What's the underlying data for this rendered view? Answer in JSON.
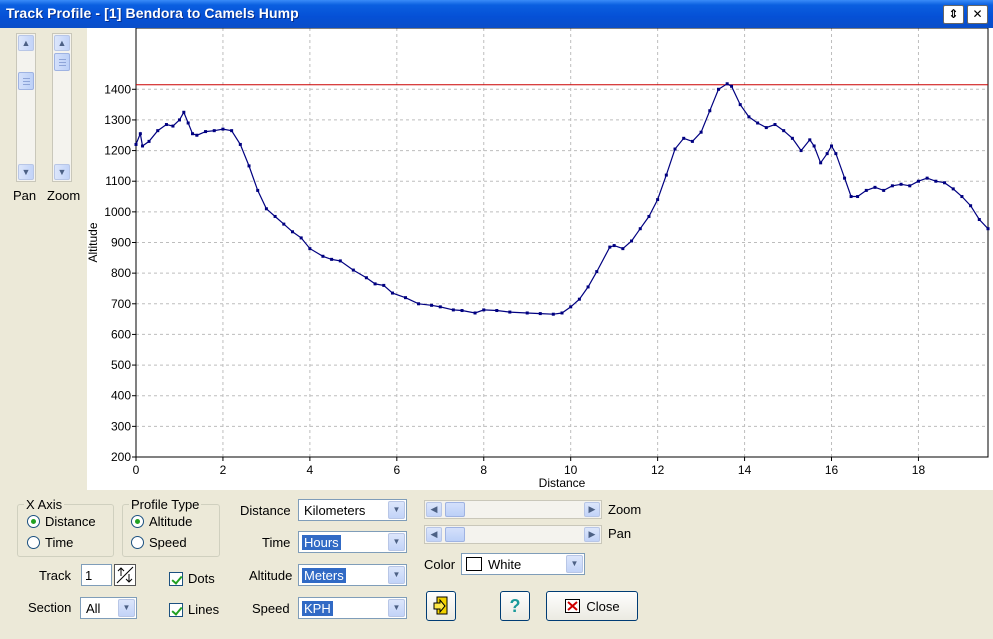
{
  "window": {
    "title": "Track Profile - [1] Bendora to Camels Hump"
  },
  "left_panel": {
    "pan_label": "Pan",
    "zoom_label": "Zoom"
  },
  "x_axis_group": {
    "title": "X Axis",
    "options": [
      "Distance",
      "Time"
    ],
    "selected": "Distance"
  },
  "profile_group": {
    "title": "Profile Type",
    "options": [
      "Altitude",
      "Speed"
    ],
    "selected": "Altitude"
  },
  "track": {
    "label": "Track",
    "value": "1"
  },
  "section": {
    "label": "Section",
    "value": "All"
  },
  "checks": {
    "dots_label": "Dots",
    "dots": true,
    "lines_label": "Lines",
    "lines": true
  },
  "units": {
    "distance_label": "Distance",
    "distance_value": "Kilometers",
    "time_label": "Time",
    "time_value": "Hours",
    "altitude_label": "Altitude",
    "altitude_value": "Meters",
    "speed_label": "Speed",
    "speed_value": "KPH"
  },
  "sliders": {
    "zoom_label": "Zoom",
    "pan_label": "Pan"
  },
  "color": {
    "label": "Color",
    "value": "White",
    "swatch": "#ffffff"
  },
  "buttons": {
    "close_label": "Close",
    "help_glyph": "?"
  },
  "chart_data": {
    "type": "line",
    "xlabel": "Distance",
    "ylabel": "Altitude",
    "xlim": [
      0,
      19.6
    ],
    "ylim": [
      200,
      1600
    ],
    "xticks": [
      0,
      2,
      4,
      6,
      8,
      10,
      12,
      14,
      16,
      18
    ],
    "yticks": [
      200,
      300,
      400,
      500,
      600,
      700,
      800,
      900,
      1000,
      1100,
      1200,
      1300,
      1400
    ],
    "max_line": 1415,
    "grid": true,
    "line_color": "#000080",
    "max_line_color": "#cc0000",
    "points": [
      [
        0,
        1220
      ],
      [
        0.1,
        1255
      ],
      [
        0.15,
        1215
      ],
      [
        0.3,
        1230
      ],
      [
        0.5,
        1265
      ],
      [
        0.7,
        1285
      ],
      [
        0.85,
        1280
      ],
      [
        1.0,
        1300
      ],
      [
        1.1,
        1325
      ],
      [
        1.2,
        1290
      ],
      [
        1.3,
        1255
      ],
      [
        1.4,
        1250
      ],
      [
        1.6,
        1262
      ],
      [
        1.8,
        1265
      ],
      [
        2.0,
        1270
      ],
      [
        2.2,
        1265
      ],
      [
        2.4,
        1220
      ],
      [
        2.6,
        1150
      ],
      [
        2.8,
        1070
      ],
      [
        3.0,
        1010
      ],
      [
        3.2,
        985
      ],
      [
        3.4,
        960
      ],
      [
        3.6,
        935
      ],
      [
        3.8,
        915
      ],
      [
        4.0,
        880
      ],
      [
        4.3,
        855
      ],
      [
        4.5,
        845
      ],
      [
        4.7,
        840
      ],
      [
        5.0,
        810
      ],
      [
        5.3,
        785
      ],
      [
        5.5,
        765
      ],
      [
        5.7,
        760
      ],
      [
        5.9,
        735
      ],
      [
        6.2,
        720
      ],
      [
        6.5,
        700
      ],
      [
        6.8,
        695
      ],
      [
        7.0,
        690
      ],
      [
        7.3,
        680
      ],
      [
        7.5,
        678
      ],
      [
        7.8,
        670
      ],
      [
        8.0,
        680
      ],
      [
        8.3,
        678
      ],
      [
        8.6,
        673
      ],
      [
        9.0,
        670
      ],
      [
        9.3,
        668
      ],
      [
        9.6,
        666
      ],
      [
        9.8,
        670
      ],
      [
        10.0,
        690
      ],
      [
        10.2,
        715
      ],
      [
        10.4,
        755
      ],
      [
        10.6,
        805
      ],
      [
        10.9,
        885
      ],
      [
        11.0,
        890
      ],
      [
        11.2,
        880
      ],
      [
        11.4,
        905
      ],
      [
        11.6,
        945
      ],
      [
        11.8,
        985
      ],
      [
        12.0,
        1040
      ],
      [
        12.2,
        1120
      ],
      [
        12.4,
        1205
      ],
      [
        12.6,
        1240
      ],
      [
        12.8,
        1230
      ],
      [
        13.0,
        1260
      ],
      [
        13.2,
        1330
      ],
      [
        13.4,
        1400
      ],
      [
        13.6,
        1418
      ],
      [
        13.7,
        1410
      ],
      [
        13.9,
        1350
      ],
      [
        14.1,
        1310
      ],
      [
        14.3,
        1290
      ],
      [
        14.5,
        1275
      ],
      [
        14.7,
        1285
      ],
      [
        14.9,
        1265
      ],
      [
        15.1,
        1240
      ],
      [
        15.3,
        1200
      ],
      [
        15.5,
        1235
      ],
      [
        15.6,
        1215
      ],
      [
        15.75,
        1160
      ],
      [
        15.9,
        1190
      ],
      [
        16.0,
        1215
      ],
      [
        16.1,
        1190
      ],
      [
        16.3,
        1110
      ],
      [
        16.45,
        1050
      ],
      [
        16.6,
        1050
      ],
      [
        16.8,
        1070
      ],
      [
        17.0,
        1080
      ],
      [
        17.2,
        1070
      ],
      [
        17.4,
        1085
      ],
      [
        17.6,
        1090
      ],
      [
        17.8,
        1085
      ],
      [
        18.0,
        1100
      ],
      [
        18.2,
        1110
      ],
      [
        18.4,
        1100
      ],
      [
        18.6,
        1095
      ],
      [
        18.8,
        1075
      ],
      [
        19.0,
        1050
      ],
      [
        19.2,
        1020
      ],
      [
        19.4,
        975
      ],
      [
        19.6,
        945
      ]
    ]
  }
}
